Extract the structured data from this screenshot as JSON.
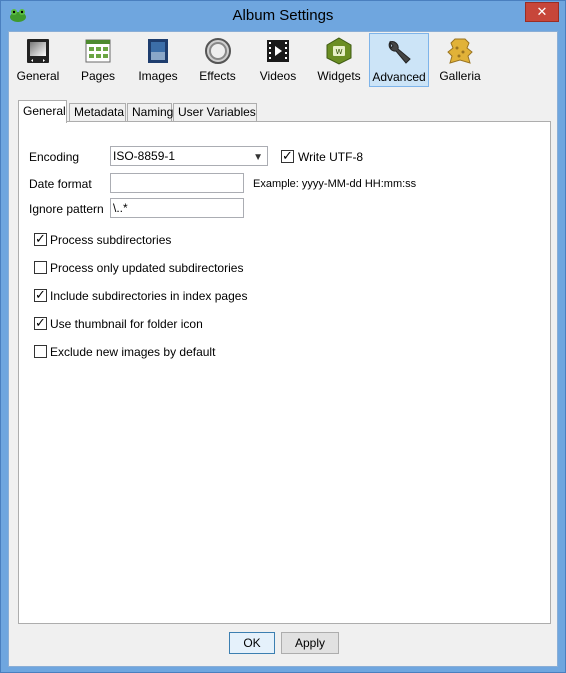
{
  "window": {
    "title": "Album Settings",
    "close_glyph": "✕"
  },
  "toolbar": {
    "items": [
      {
        "label": "General",
        "icon": "general-icon"
      },
      {
        "label": "Pages",
        "icon": "pages-icon"
      },
      {
        "label": "Images",
        "icon": "images-icon"
      },
      {
        "label": "Effects",
        "icon": "effects-icon"
      },
      {
        "label": "Videos",
        "icon": "videos-icon"
      },
      {
        "label": "Widgets",
        "icon": "widgets-icon"
      },
      {
        "label": "Advanced",
        "icon": "advanced-icon",
        "selected": true
      },
      {
        "label": "Galleria",
        "icon": "galleria-icon"
      }
    ]
  },
  "tabs": [
    {
      "label": "General",
      "active": true
    },
    {
      "label": "Metadata"
    },
    {
      "label": "Naming"
    },
    {
      "label": "User Variables"
    }
  ],
  "form": {
    "encoding_label": "Encoding",
    "encoding_value": "ISO-8859-1",
    "write_utf8_label": "Write UTF-8",
    "write_utf8_checked": true,
    "date_format_label": "Date format",
    "date_format_value": "",
    "date_example": "Example: yyyy-MM-dd HH:mm:ss",
    "ignore_pattern_label": "Ignore pattern",
    "ignore_pattern_value": "\\..*"
  },
  "options": [
    {
      "label": "Process subdirectories",
      "checked": true
    },
    {
      "label": "Process only updated subdirectories",
      "checked": false
    },
    {
      "label": "Include subdirectories in index pages",
      "checked": true
    },
    {
      "label": "Use thumbnail for folder icon",
      "checked": true
    },
    {
      "label": "Exclude new images by default",
      "checked": false
    }
  ],
  "buttons": {
    "ok": "OK",
    "apply": "Apply"
  },
  "colors": {
    "accent": "#6fa6df",
    "selected_tool": "#cce4f7",
    "close": "#c7463a"
  }
}
